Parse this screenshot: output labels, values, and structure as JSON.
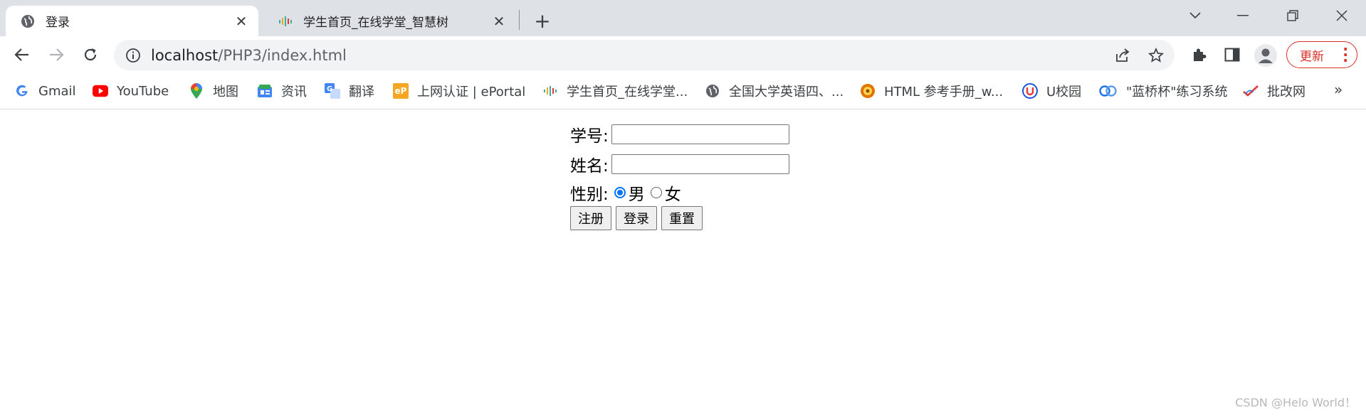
{
  "browser": {
    "tabs": [
      {
        "title": "登录",
        "icon": "globe-icon",
        "active": true
      },
      {
        "title": "学生首页_在线学堂_智慧树",
        "icon": "zhihuishu-icon",
        "active": false
      }
    ],
    "address": {
      "host": "localhost",
      "path": "/PHP3/index.html"
    },
    "update_label": "更新",
    "bookmarks": [
      {
        "label": "Gmail",
        "icon": "google-icon",
        "color": "#4285f4"
      },
      {
        "label": "YouTube",
        "icon": "youtube-icon",
        "color": "#ff0000"
      },
      {
        "label": "地图",
        "icon": "maps-icon",
        "color": "#34a853"
      },
      {
        "label": "资讯",
        "icon": "news-icon",
        "color": "#4285f4"
      },
      {
        "label": "翻译",
        "icon": "translate-icon",
        "color": "#4285f4"
      },
      {
        "label": "上网认证 | ePortal",
        "icon": "eportal-icon",
        "color": "#f5a623"
      },
      {
        "label": "学生首页_在线学堂...",
        "icon": "zhihuishu-icon",
        "color": "#3ab0a0"
      },
      {
        "label": "全国大学英语四、...",
        "icon": "globe-icon",
        "color": "#5f6368"
      },
      {
        "label": "HTML 参考手册_w...",
        "icon": "runoob-icon",
        "color": "#e37400"
      },
      {
        "label": "U校园",
        "icon": "uxiaoyuan-icon",
        "color": "#1a56db"
      },
      {
        "label": "\"蓝桥杯\"练习系统",
        "icon": "lanqiao-icon",
        "color": "#1a73e8"
      },
      {
        "label": "批改网",
        "icon": "pigai-icon",
        "color": "#e53935"
      }
    ]
  },
  "form": {
    "student_id_label": "学号:",
    "name_label": "姓名:",
    "gender_label": "性别:",
    "gender_options": [
      {
        "label": "男",
        "checked": true
      },
      {
        "label": "女",
        "checked": false
      }
    ],
    "buttons": {
      "register": "注册",
      "login": "登录",
      "reset": "重置"
    }
  },
  "watermark": "CSDN @Helo World！"
}
